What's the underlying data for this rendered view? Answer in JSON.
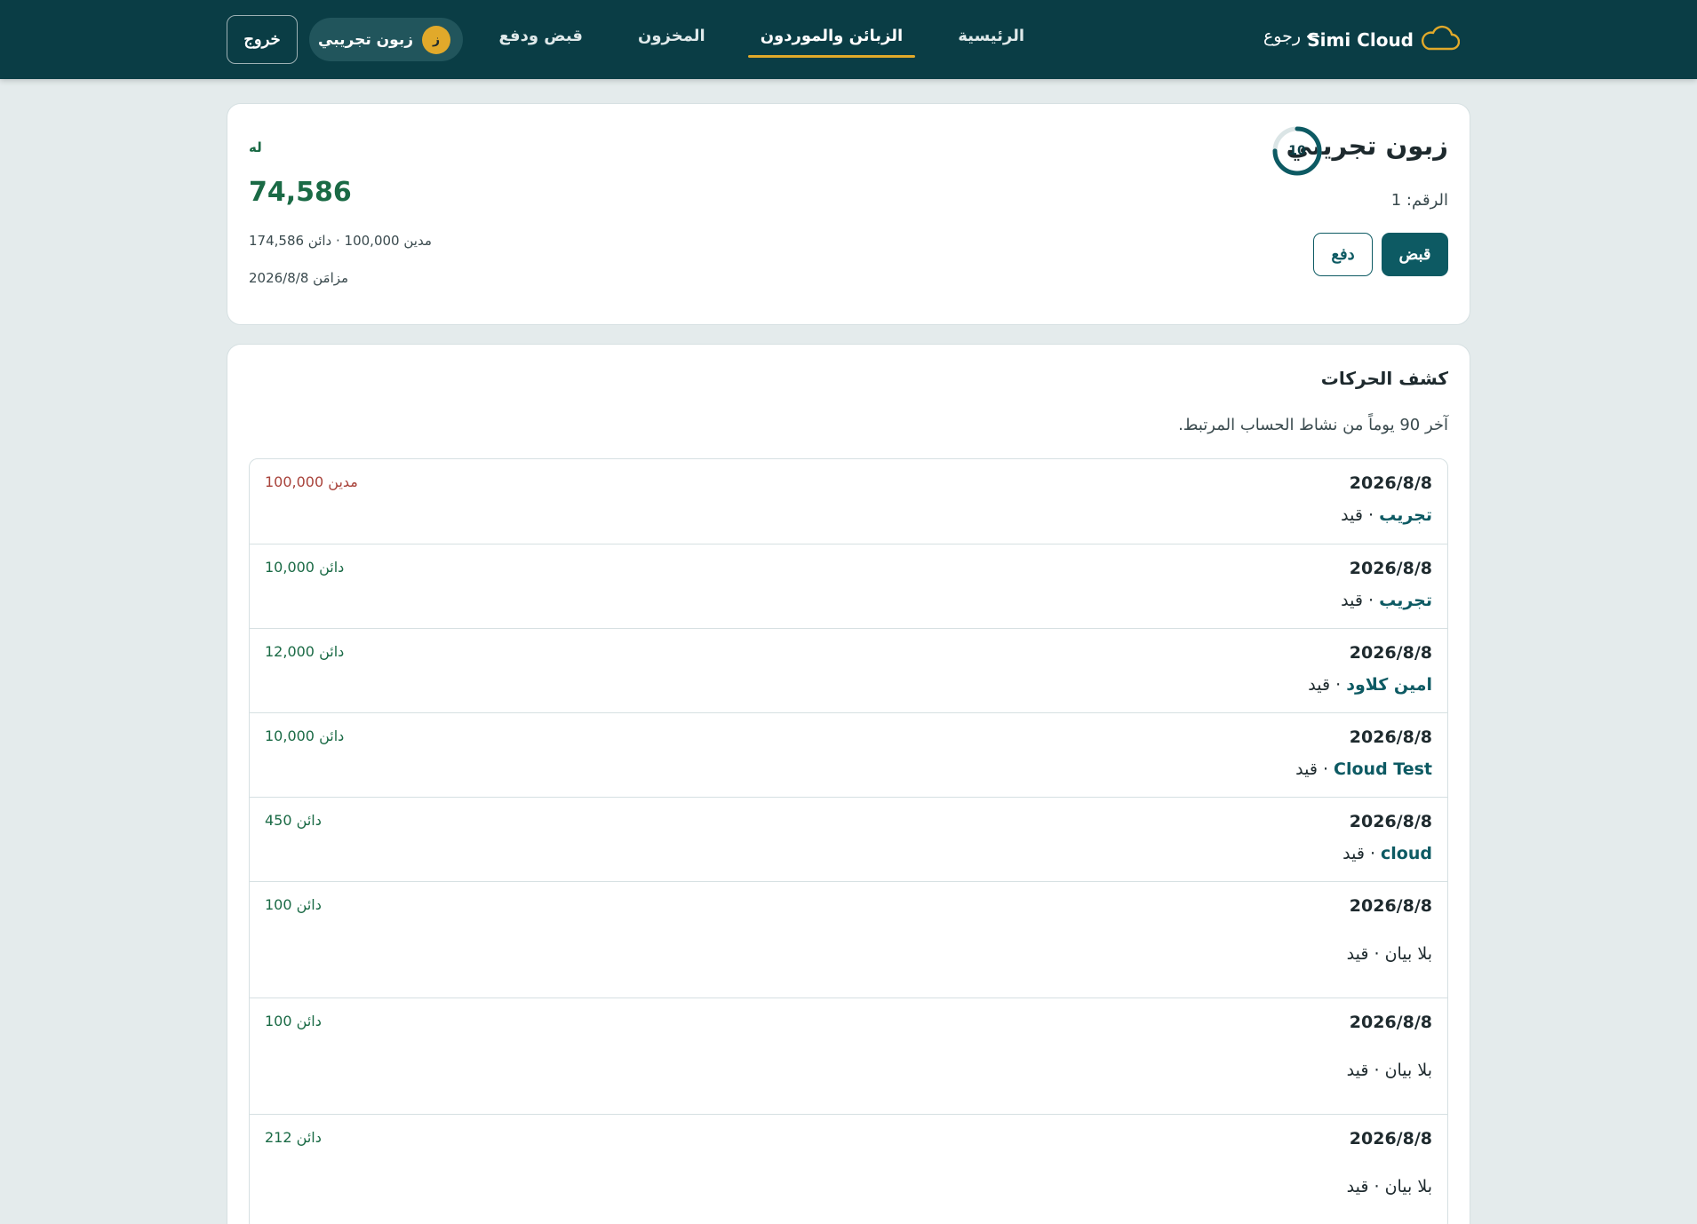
{
  "app": {
    "brand_name": "Simi Cloud",
    "back_label": "← رجوع",
    "logout_label": "خروج",
    "user_initial": "ز",
    "user_name": "زبون تجريبي",
    "nav": [
      {
        "label": "الرئيسية"
      },
      {
        "label": "الزبائن والموردون"
      },
      {
        "label": "المخزون"
      },
      {
        "label": "قبض ودفع"
      }
    ],
    "active_nav": "الزبائن والموردون",
    "accent_color": "#e1a92a",
    "header_color": "#0a3d45"
  },
  "customer": {
    "name": "زبون تجريبي",
    "score": "10",
    "score_fraction": 0.75,
    "id_text": "الرقم: 1",
    "receive_label": "قبض",
    "pay_label": "دفع",
    "balance_direction": "له",
    "balance_amount": "74,586",
    "balance_details": "مدين 100,000 · دائن 174,586",
    "synced_text": "مزامَن 2026/8/8"
  },
  "statement": {
    "title": "كشف الحركات",
    "subtitle": "آخر 90 يوماً من نشاط الحساب المرتبط.",
    "rows": [
      {
        "date": "2026/8/8",
        "desc_main": "تجريب",
        "desc_type": " · قيد",
        "amount": "مدين 100,000",
        "kind": "debit"
      },
      {
        "date": "2026/8/8",
        "desc_main": "تجريب",
        "desc_type": " · قيد",
        "amount": "دائن 10,000",
        "kind": "credit"
      },
      {
        "date": "2026/8/8",
        "desc_main": "امين كلاود",
        "desc_type": " · قيد",
        "amount": "دائن 12,000",
        "kind": "credit"
      },
      {
        "date": "2026/8/8",
        "desc_main": "Cloud Test",
        "desc_type": " · قيد",
        "amount": "دائن 10,000",
        "kind": "credit"
      },
      {
        "date": "2026/8/8",
        "desc_main": "cloud",
        "desc_type": " · قيد",
        "amount": "دائن 450",
        "kind": "credit"
      },
      {
        "date": "2026/8/8",
        "desc_main": "بلا بيان",
        "desc_type": " · قيد",
        "amount": "دائن 100",
        "kind": "credit"
      },
      {
        "date": "2026/8/8",
        "desc_main": "بلا بيان",
        "desc_type": " · قيد",
        "amount": "دائن 100",
        "kind": "credit"
      },
      {
        "date": "2026/8/8",
        "desc_main": "بلا بيان",
        "desc_type": " · قيد",
        "amount": "دائن 212",
        "kind": "credit"
      }
    ]
  }
}
